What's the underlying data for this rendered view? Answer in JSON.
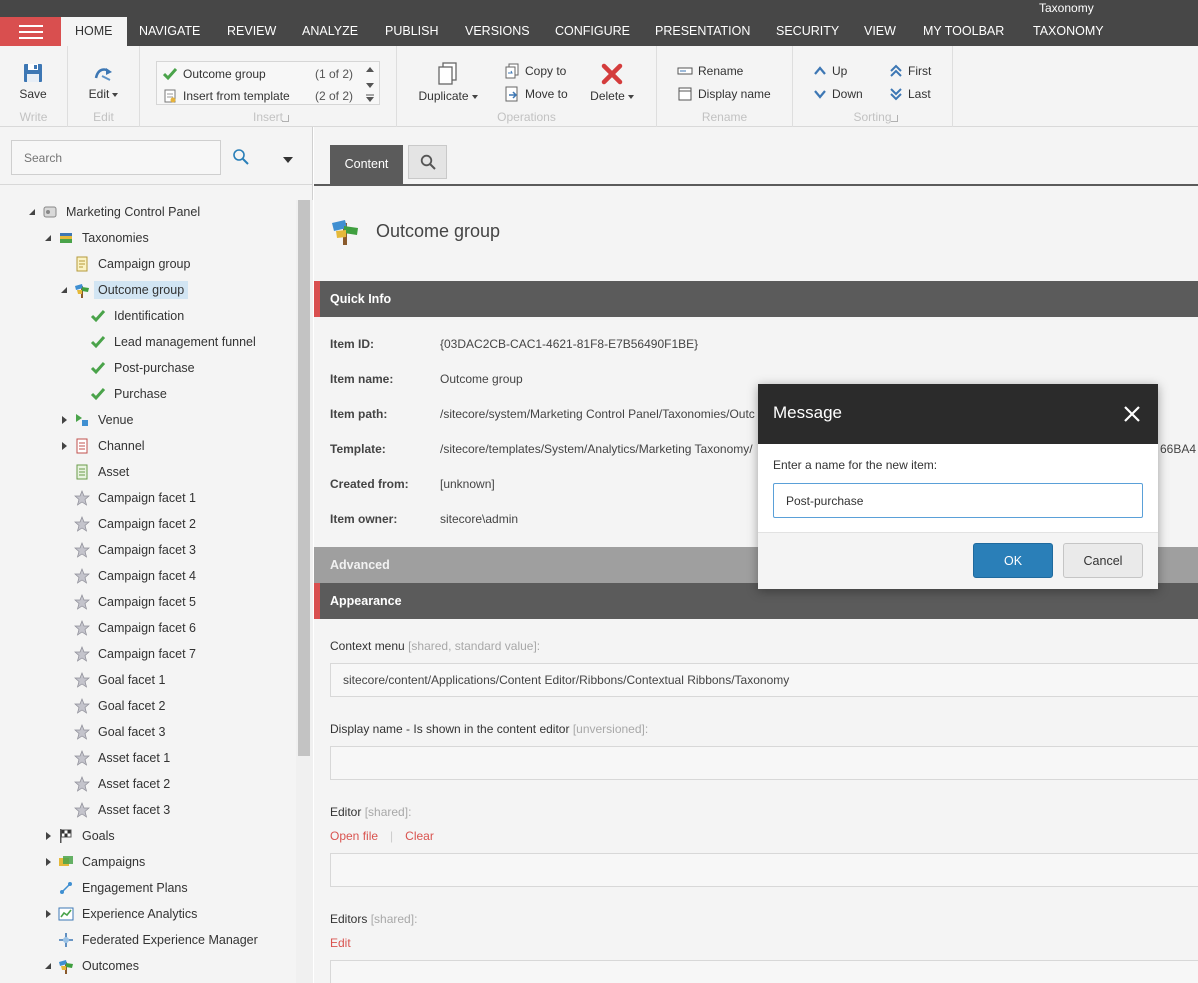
{
  "app": {
    "context_tab_group": "Taxonomy"
  },
  "tabs": [
    "HOME",
    "NAVIGATE",
    "REVIEW",
    "ANALYZE",
    "PUBLISH",
    "VERSIONS",
    "CONFIGURE",
    "PRESENTATION",
    "SECURITY",
    "VIEW",
    "MY TOOLBAR",
    "TAXONOMY"
  ],
  "active_tab": "HOME",
  "ribbon": {
    "write": {
      "title": "Write",
      "save": "Save"
    },
    "edit": {
      "title": "Edit",
      "edit": "Edit"
    },
    "insert": {
      "title": "Insert",
      "items": [
        {
          "label": "Outcome group",
          "count": "(1 of 2)"
        },
        {
          "label": "Insert from template",
          "count": "(2 of 2)"
        }
      ]
    },
    "operations": {
      "title": "Operations",
      "duplicate": "Duplicate",
      "copy_to": "Copy to",
      "move_to": "Move to",
      "delete": "Delete"
    },
    "rename": {
      "title": "Rename",
      "rename": "Rename",
      "display_name": "Display name"
    },
    "sorting": {
      "title": "Sorting",
      "up": "Up",
      "down": "Down",
      "first": "First",
      "last": "Last"
    }
  },
  "search": {
    "placeholder": "Search"
  },
  "tree": [
    {
      "label": "Marketing Control Panel",
      "depth": 0,
      "expander": "expanded",
      "icon": "control-panel-icon"
    },
    {
      "label": "Taxonomies",
      "depth": 1,
      "expander": "expanded",
      "icon": "books-icon"
    },
    {
      "label": "Campaign group",
      "depth": 2,
      "expander": "none",
      "icon": "document-icon"
    },
    {
      "label": "Outcome group",
      "depth": 2,
      "expander": "expanded",
      "icon": "signpost-icon",
      "selected": true
    },
    {
      "label": "Identification",
      "depth": 3,
      "expander": "none",
      "icon": "checkmark-icon"
    },
    {
      "label": "Lead management funnel",
      "depth": 3,
      "expander": "none",
      "icon": "checkmark-icon"
    },
    {
      "label": "Post-purchase",
      "depth": 3,
      "expander": "none",
      "icon": "checkmark-icon"
    },
    {
      "label": "Purchase",
      "depth": 3,
      "expander": "none",
      "icon": "checkmark-icon"
    },
    {
      "label": "Venue",
      "depth": 2,
      "expander": "collapsed",
      "icon": "venue-icon"
    },
    {
      "label": "Channel",
      "depth": 2,
      "expander": "collapsed",
      "icon": "channel-icon"
    },
    {
      "label": "Asset",
      "depth": 2,
      "expander": "none",
      "icon": "asset-icon"
    },
    {
      "label": "Campaign facet 1",
      "depth": 2,
      "expander": "none",
      "icon": "star-icon"
    },
    {
      "label": "Campaign facet 2",
      "depth": 2,
      "expander": "none",
      "icon": "star-icon"
    },
    {
      "label": "Campaign facet 3",
      "depth": 2,
      "expander": "none",
      "icon": "star-icon"
    },
    {
      "label": "Campaign facet 4",
      "depth": 2,
      "expander": "none",
      "icon": "star-icon"
    },
    {
      "label": "Campaign facet 5",
      "depth": 2,
      "expander": "none",
      "icon": "star-icon"
    },
    {
      "label": "Campaign facet 6",
      "depth": 2,
      "expander": "none",
      "icon": "star-icon"
    },
    {
      "label": "Campaign facet 7",
      "depth": 2,
      "expander": "none",
      "icon": "star-icon"
    },
    {
      "label": "Goal facet 1",
      "depth": 2,
      "expander": "none",
      "icon": "star-icon"
    },
    {
      "label": "Goal facet 2",
      "depth": 2,
      "expander": "none",
      "icon": "star-icon"
    },
    {
      "label": "Goal facet 3",
      "depth": 2,
      "expander": "none",
      "icon": "star-icon"
    },
    {
      "label": "Asset facet 1",
      "depth": 2,
      "expander": "none",
      "icon": "star-icon"
    },
    {
      "label": "Asset facet 2",
      "depth": 2,
      "expander": "none",
      "icon": "star-icon"
    },
    {
      "label": "Asset facet 3",
      "depth": 2,
      "expander": "none",
      "icon": "star-icon"
    },
    {
      "label": "Goals",
      "depth": 1,
      "expander": "collapsed",
      "icon": "flag-icon"
    },
    {
      "label": "Campaigns",
      "depth": 1,
      "expander": "collapsed",
      "icon": "campaigns-icon"
    },
    {
      "label": "Engagement Plans",
      "depth": 1,
      "expander": "none",
      "icon": "engagement-icon"
    },
    {
      "label": "Experience Analytics",
      "depth": 1,
      "expander": "collapsed",
      "icon": "chart-icon"
    },
    {
      "label": "Federated Experience Manager",
      "depth": 1,
      "expander": "none",
      "icon": "fxm-icon"
    },
    {
      "label": "Outcomes",
      "depth": 1,
      "expander": "expanded",
      "icon": "signpost-icon"
    }
  ],
  "editor": {
    "tabs": {
      "content": "Content"
    },
    "item_title": "Outcome group",
    "sections": {
      "quick_info": "Quick Info",
      "advanced": "Advanced",
      "appearance": "Appearance"
    },
    "quick_info": [
      {
        "label": "Item ID:",
        "value": "{03DAC2CB-CAC1-4621-81F8-E7B56490F1BE}"
      },
      {
        "label": "Item name:",
        "value": "Outcome group"
      },
      {
        "label": "Item path:",
        "value": "/sitecore/system/Marketing Control Panel/Taxonomies/Outc"
      },
      {
        "label": "Template:",
        "value": "/sitecore/templates/System/Analytics/Marketing Taxonomy/"
      },
      {
        "label": "Created from:",
        "value": "[unknown]"
      },
      {
        "label": "Item owner:",
        "value": "sitecore\\admin"
      }
    ],
    "template_id_tail": "66BA4",
    "fields": {
      "context_menu": {
        "label": "Context menu",
        "hint": "[shared, standard value]:",
        "value": "sitecore/content/Applications/Content Editor/Ribbons/Contextual Ribbons/Taxonomy"
      },
      "display_name": {
        "label": "Display name - Is shown in the content editor",
        "hint": "[unversioned]:",
        "value": ""
      },
      "editor": {
        "label": "Editor",
        "hint": "[shared]:",
        "links": [
          "Open file",
          "Clear"
        ],
        "value": ""
      },
      "editors": {
        "label": "Editors",
        "hint": "[shared]:",
        "links": [
          "Edit"
        ],
        "value": ""
      }
    }
  },
  "dialog": {
    "title": "Message",
    "prompt": "Enter a name for the new item:",
    "input_value": "Post-purchase",
    "ok": "OK",
    "cancel": "Cancel"
  },
  "colors": {
    "accent_red": "#d94f4f",
    "ok_blue": "#2a7fb8",
    "dark_bar": "#474747",
    "section_dark": "#5b5b5b"
  }
}
